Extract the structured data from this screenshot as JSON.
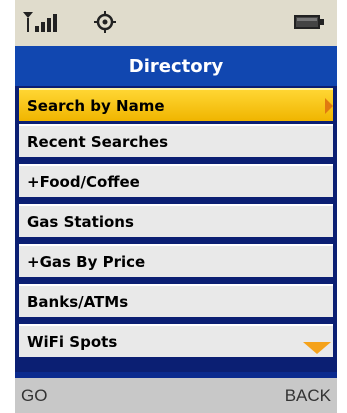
{
  "status": {
    "signal_icon": "signal-strength-icon",
    "gear_icon": "gear-icon",
    "battery_icon": "battery-icon"
  },
  "title": "Directory",
  "menu": {
    "items": [
      {
        "label": "Search by Name",
        "selected": true
      },
      {
        "label": "Recent Searches",
        "selected": false
      },
      {
        "label": "+Food/Coffee",
        "selected": false
      },
      {
        "label": "Gas Stations",
        "selected": false
      },
      {
        "label": "+Gas By Price",
        "selected": false
      },
      {
        "label": "Banks/ATMs",
        "selected": false
      },
      {
        "label": "WiFi Spots",
        "selected": false
      }
    ]
  },
  "softkeys": {
    "left": "GO",
    "right": "BACK"
  },
  "colors": {
    "title_bar": "#1147b0",
    "selected_item": "#f0b500",
    "item_bg": "#e9e9e9",
    "status_bar": "#e0dccc"
  }
}
